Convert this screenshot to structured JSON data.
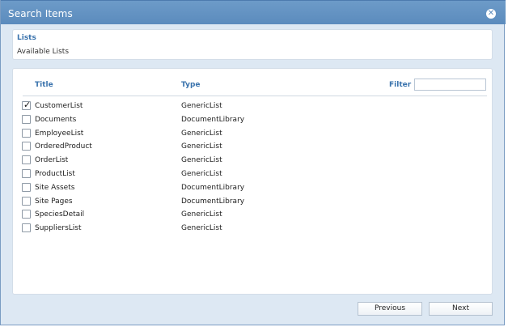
{
  "dialog": {
    "title": "Search Items",
    "close_icon": "close-circle-icon"
  },
  "lists_panel": {
    "heading": "Lists",
    "subtitle": "Available Lists"
  },
  "table": {
    "headers": {
      "title": "Title",
      "type": "Type",
      "filter": "Filter"
    },
    "filter_value": "",
    "rows": [
      {
        "title": "CustomerList",
        "type": "GenericList",
        "checked": true
      },
      {
        "title": "Documents",
        "type": "DocumentLibrary",
        "checked": false
      },
      {
        "title": "EmployeeList",
        "type": "GenericList",
        "checked": false
      },
      {
        "title": "OrderedProduct",
        "type": "GenericList",
        "checked": false
      },
      {
        "title": "OrderList",
        "type": "GenericList",
        "checked": false
      },
      {
        "title": "ProductList",
        "type": "GenericList",
        "checked": false
      },
      {
        "title": "Site Assets",
        "type": "DocumentLibrary",
        "checked": false
      },
      {
        "title": "Site Pages",
        "type": "DocumentLibrary",
        "checked": false
      },
      {
        "title": "SpeciesDetail",
        "type": "GenericList",
        "checked": false
      },
      {
        "title": "SuppliersList",
        "type": "GenericList",
        "checked": false
      }
    ]
  },
  "buttons": {
    "previous": "Previous",
    "next": "Next"
  },
  "colors": {
    "titlebar": "#5b8bbd",
    "accent": "#3a73ad",
    "dialog_bg": "#dde8f3"
  }
}
